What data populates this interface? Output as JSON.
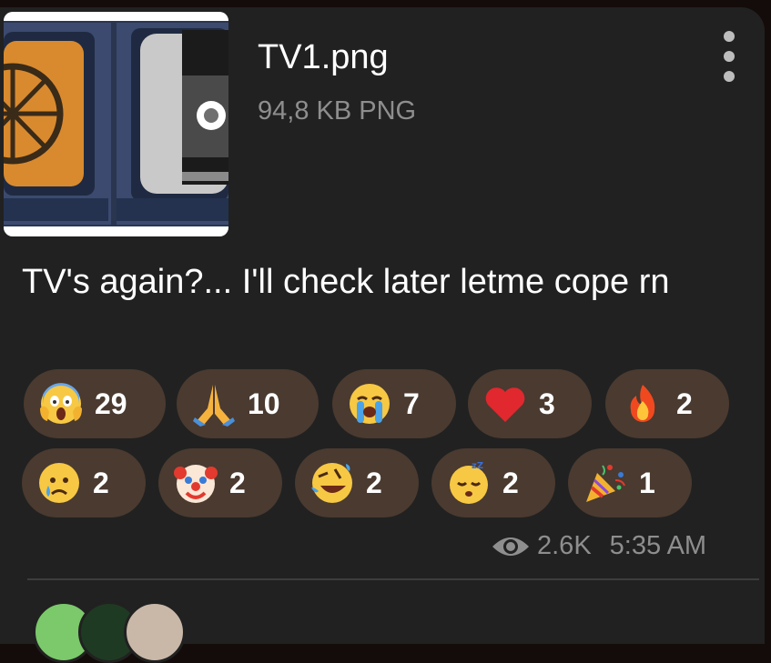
{
  "file": {
    "name": "TV1.png",
    "meta": "94,8 KB PNG"
  },
  "caption": "TV's again?... I'll check later letme cope rn",
  "reactions_row1": [
    {
      "icon": "screaming-face-icon",
      "count": "29"
    },
    {
      "icon": "folded-hands-icon",
      "count": "10"
    },
    {
      "icon": "loudly-crying-face-icon",
      "count": "7"
    },
    {
      "icon": "red-heart-icon",
      "count": "3"
    },
    {
      "icon": "fire-icon",
      "count": "2"
    }
  ],
  "reactions_row2": [
    {
      "icon": "sad-tear-face-icon",
      "count": "2"
    },
    {
      "icon": "clown-face-icon",
      "count": "2"
    },
    {
      "icon": "rolling-laughing-face-icon",
      "count": "2"
    },
    {
      "icon": "sleeping-face-icon",
      "count": "2"
    },
    {
      "icon": "party-popper-icon",
      "count": "1"
    }
  ],
  "footer": {
    "views": "2.6K",
    "time": "5:35 AM"
  },
  "colors": {
    "bubble_bg": "#212121",
    "reaction_bg": "#4a3a30",
    "meta_text": "#8e8e8e"
  }
}
